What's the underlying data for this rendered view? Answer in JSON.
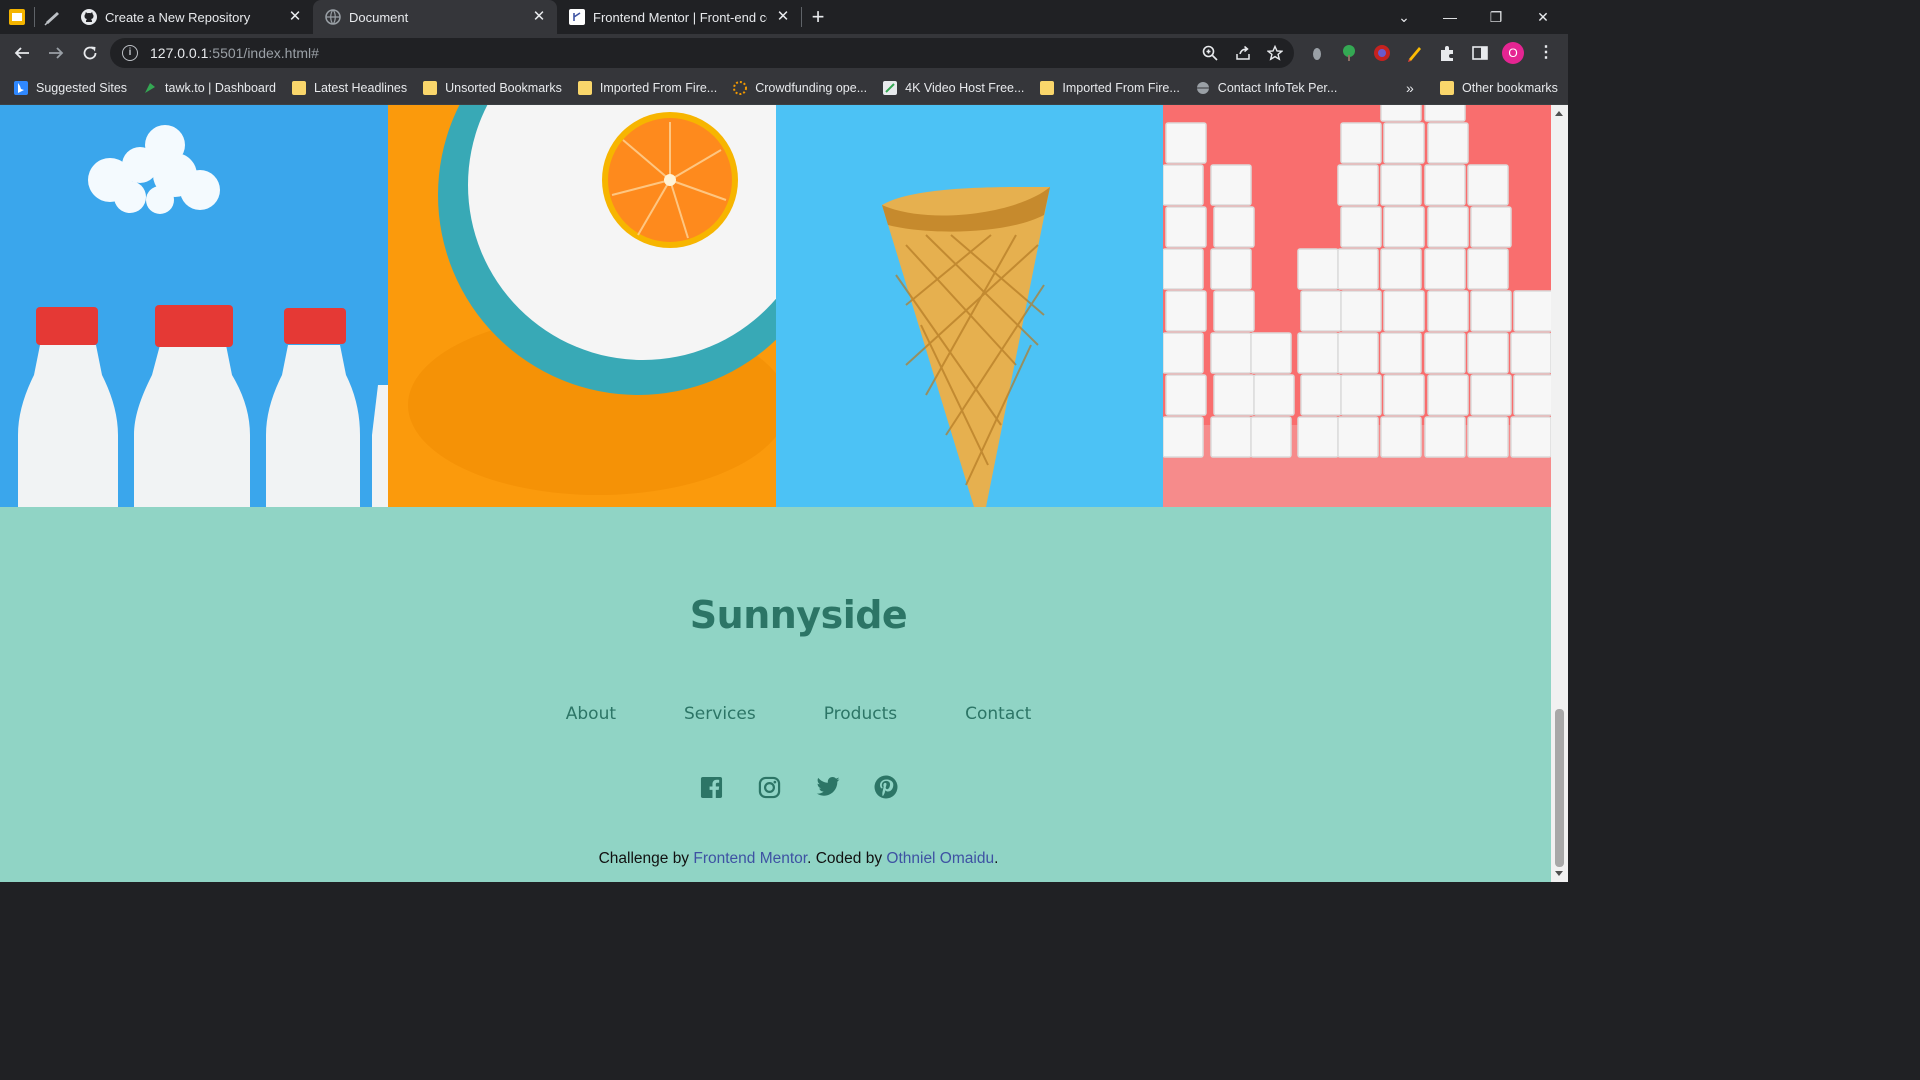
{
  "browser": {
    "tabs": [
      {
        "title": "Create a New Repository",
        "active": false
      },
      {
        "title": "Document",
        "active": true
      },
      {
        "title": "Frontend Mentor | Front-end coding challenges",
        "active": false
      }
    ],
    "address": {
      "host": "127.0.0.1",
      "rest": ":5501/index.html#"
    },
    "profile_initial": "O",
    "bookmarks": [
      "Suggested Sites",
      "tawk.to | Dashboard",
      "Latest Headlines",
      "Unsorted Bookmarks",
      "Imported From Fire...",
      "Crowdfunding ope...",
      "4K Video Host Free...",
      "Imported From Fire...",
      "Contact InfoTek Per..."
    ],
    "bookmarks_overflow": "»",
    "other_bookmarks": "Other bookmarks"
  },
  "gallery": [
    {
      "name": "milk-bottles"
    },
    {
      "name": "orange-on-plate"
    },
    {
      "name": "waffle-cone"
    },
    {
      "name": "sugar-cubes"
    }
  ],
  "footer": {
    "brand": "Sunnyside",
    "nav": [
      "About",
      "Services",
      "Products",
      "Contact"
    ],
    "socials": [
      "facebook-icon",
      "instagram-icon",
      "twitter-icon",
      "pinterest-icon"
    ],
    "attribution": {
      "prefix": "Challenge by ",
      "link1": "Frontend Mentor",
      "middle": ". Coded by ",
      "link2": "Othniel Omaidu",
      "suffix": "."
    }
  },
  "colors": {
    "footer_bg": "#90d4c5",
    "footer_text": "#2c7566",
    "link": "#3e52a3"
  }
}
